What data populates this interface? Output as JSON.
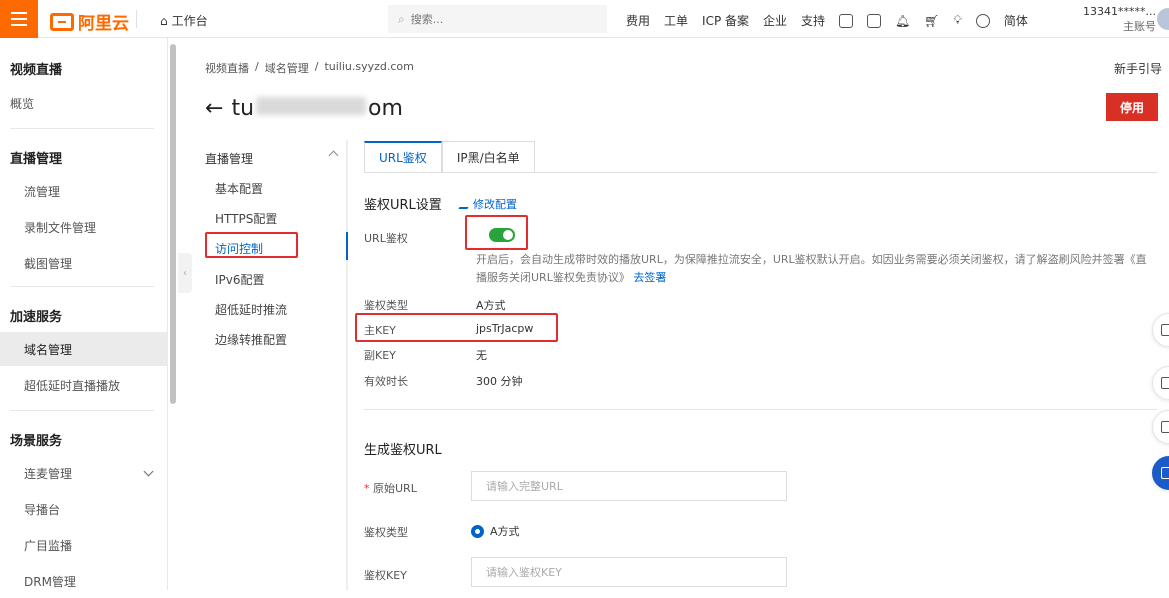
{
  "header": {
    "logo_text": "阿里云",
    "workbench_label": "工作台",
    "search_placeholder": "搜索...",
    "links": [
      "费用",
      "工单",
      "ICP 备案",
      "企业",
      "支持"
    ],
    "lang": "简体",
    "account_name": "13341*****...",
    "account_sub": "主账号"
  },
  "sidebar": {
    "product_title": "视频直播",
    "overview": "概览",
    "groups": [
      {
        "title": "直播管理",
        "items": [
          "流管理",
          "录制文件管理",
          "截图管理"
        ]
      },
      {
        "title": "加速服务",
        "items": [
          "域名管理",
          "超低延时直播播放"
        ]
      },
      {
        "title": "场景服务",
        "items": [
          "连麦管理",
          "导播台",
          "广目监播",
          "DRM管理"
        ]
      }
    ],
    "active_item": "域名管理"
  },
  "breadcrumb": {
    "items": [
      "视频直播",
      "域名管理",
      "tuiliu.syyzd.com"
    ],
    "separator": "/"
  },
  "guide_link": "新手引导",
  "page_title": {
    "prefix": "tu",
    "suffix": "om"
  },
  "stop_button": "停用",
  "subnav": {
    "group": "直播管理",
    "items": [
      "基本配置",
      "HTTPS配置",
      "访问控制",
      "IPv6配置",
      "超低延时推流",
      "边缘转推配置"
    ],
    "active": "访问控制"
  },
  "tabs": [
    "URL鉴权",
    "IP黑/白名单"
  ],
  "auth_settings": {
    "title": "鉴权URL设置",
    "edit_link": "修改配置",
    "url_auth_label": "URL鉴权",
    "url_auth_enabled": true,
    "description": "开启后，会自动生成带时效的播放URL，为保障推拉流安全，URL鉴权默认开启。如因业务需要必须关闭鉴权，请了解盗刷风险并签署《直播服务关闭URL鉴权免责协议》",
    "sign_link": "去签署",
    "fields": [
      {
        "label": "鉴权类型",
        "value": "A方式"
      },
      {
        "label": "主KEY",
        "value": "jpsTrJacpw"
      },
      {
        "label": "副KEY",
        "value": "无"
      },
      {
        "label": "有效时长",
        "value": "300 分钟"
      }
    ]
  },
  "generate": {
    "title": "生成鉴权URL",
    "original_url_label": "原始URL",
    "original_url_placeholder": "请输入完整URL",
    "auth_type_label": "鉴权类型",
    "auth_type_option": "A方式",
    "auth_key_label": "鉴权KEY",
    "auth_key_placeholder": "请输入鉴权KEY"
  },
  "colors": {
    "brand": "#ff6a00",
    "link": "#0064c8",
    "danger": "#d93026",
    "toggle_on": "#29a33b",
    "highlight_box": "#e12d2d"
  }
}
